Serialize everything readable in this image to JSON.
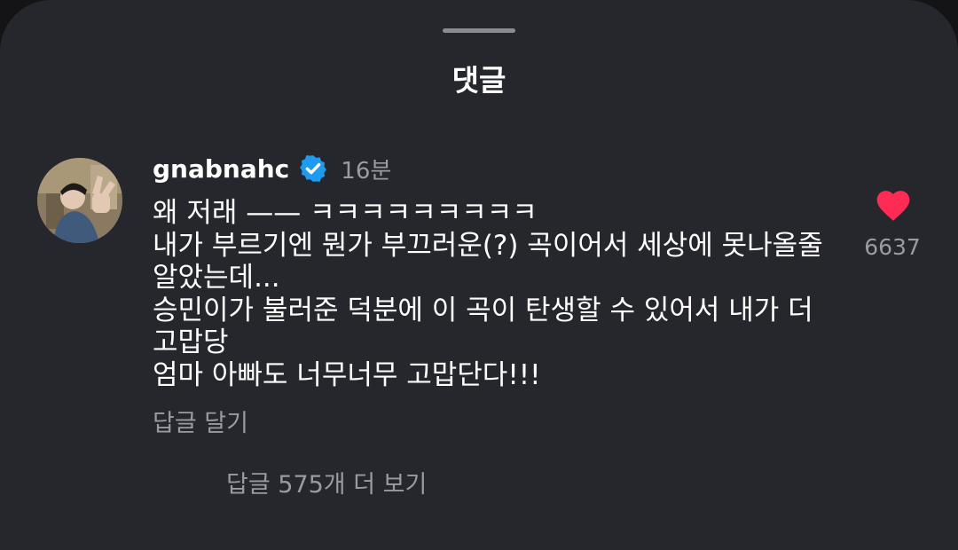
{
  "sheet": {
    "title": "댓글"
  },
  "comment": {
    "username": "gnabnahc",
    "verified_icon": "verified-badge-icon",
    "time": "16분",
    "lines": [
      "왜 저래 —— ㅋㅋㅋㅋㅋㅋㅋㅋㅋ",
      "내가 부르기엔 뭔가 부끄러운(?) 곡이어서 세상에 못나올줄",
      "알았는데...",
      "승민이가 불러준 덕분에 이 곡이 탄생할 수 있어서 내가 더",
      "고맙당",
      "엄마 아빠도 너무너무 고맙단다!!!"
    ],
    "reply_label": "답글 달기",
    "like_icon": "heart-icon",
    "like_count": "6637",
    "more_replies_label": "답글 575개 더 보기"
  },
  "colors": {
    "sheet_background": "#26272c",
    "accent_blue": "#1d9bf0",
    "like_red": "#fe2c55",
    "secondary_text": "#9a9ba0"
  }
}
